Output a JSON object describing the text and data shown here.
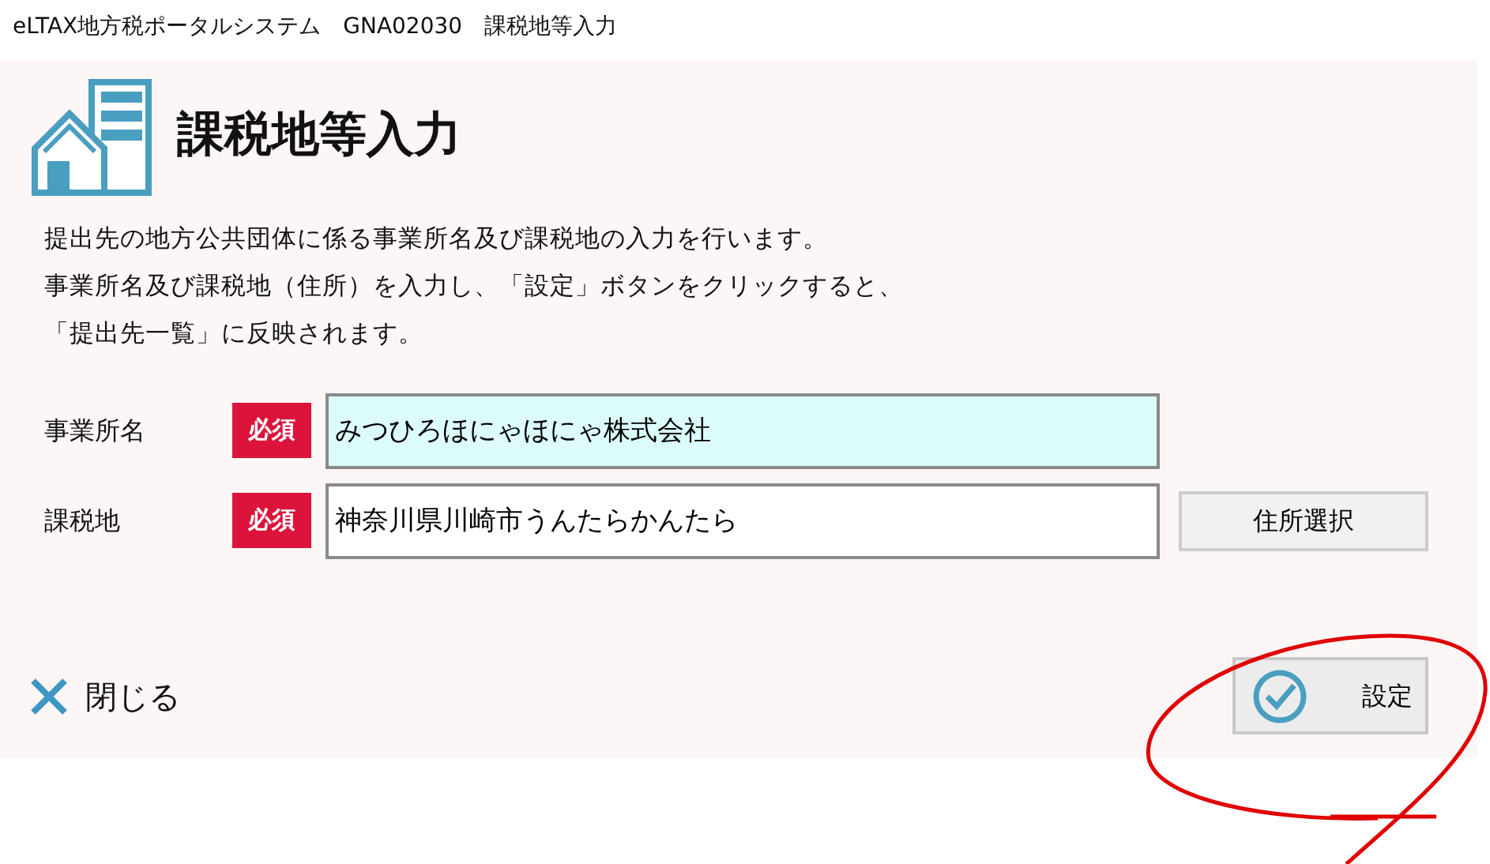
{
  "window": {
    "title": "eLTAX地方税ポータルシステム　GNA02030　課税地等入力"
  },
  "heading": "課税地等入力",
  "description": [
    "提出先の地方公共団体に係る事業所名及び課税地の入力を行います。",
    "事業所名及び課税地（住所）を入力し、「設定」ボタンをクリックすると、",
    "「提出先一覧」に反映されます。"
  ],
  "fields": [
    {
      "label": "事業所名",
      "badge": "必須",
      "value": "みつひろほにゃほにゃ株式会社",
      "focused": true
    },
    {
      "label": "課税地",
      "badge": "必須",
      "value": "神奈川県川崎市うんたらかんたら",
      "focused": false,
      "button": "住所選択"
    }
  ],
  "close_button": "閉じる",
  "submit_button": "設定"
}
